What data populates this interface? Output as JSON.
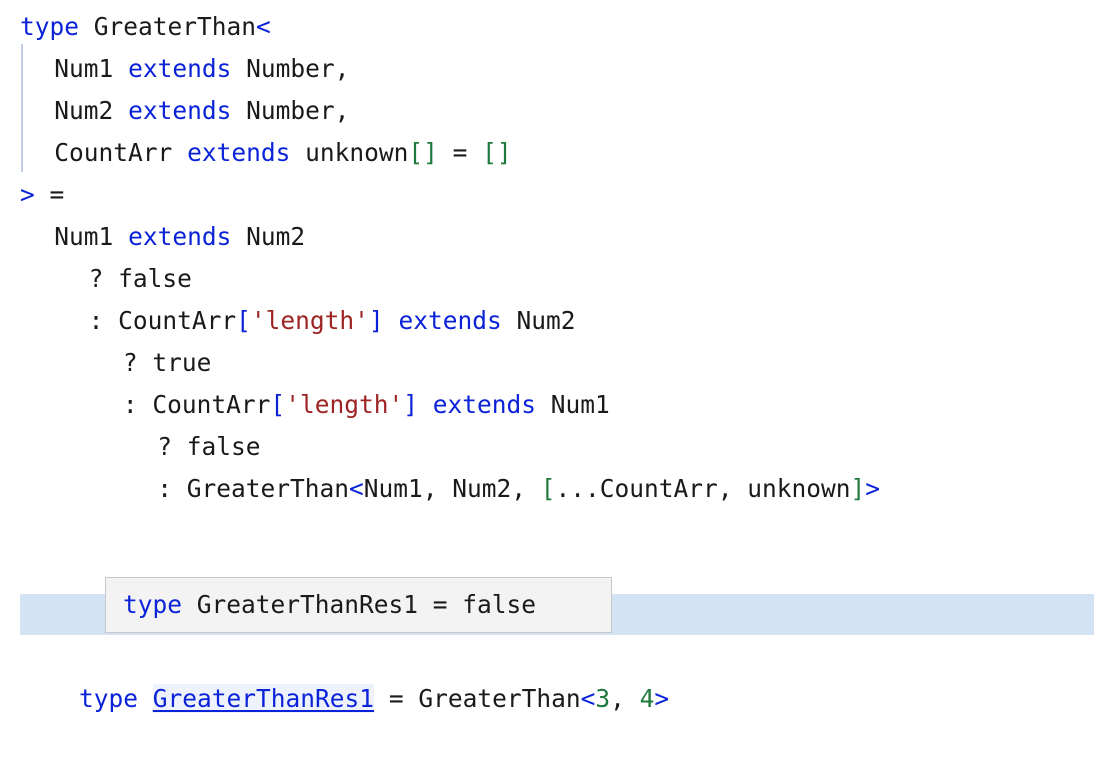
{
  "editor": {
    "language": "typescript",
    "background": "#ffffff",
    "colors": {
      "keyword": "#0b23d8",
      "identifier": "#1a1a1a",
      "string": "#9c2423",
      "number": "#1f7a3d",
      "bracket_green": "#1f7a3d",
      "bracket_blue": "#0b23d8",
      "highlight_band": "#d3e3f3",
      "tooltip_bg": "#f3f3f3",
      "tooltip_border": "#c8c8c8",
      "indent_guide": "#c3cde4",
      "link_bg": "#eef2fc"
    }
  },
  "code": {
    "lines": [
      {
        "indent": 0,
        "tokens": [
          {
            "t": "type",
            "c": "kw"
          },
          {
            "t": " ",
            "c": "punct"
          },
          {
            "t": "GreaterThan",
            "c": "ident"
          },
          {
            "t": "<",
            "c": "angle"
          }
        ]
      },
      {
        "indent": 2,
        "tokens": [
          {
            "t": "Num1",
            "c": "ident"
          },
          {
            "t": " ",
            "c": "punct"
          },
          {
            "t": "extends",
            "c": "kw"
          },
          {
            "t": " ",
            "c": "punct"
          },
          {
            "t": "Number,",
            "c": "ident"
          }
        ]
      },
      {
        "indent": 2,
        "tokens": [
          {
            "t": "Num2",
            "c": "ident"
          },
          {
            "t": " ",
            "c": "punct"
          },
          {
            "t": "extends",
            "c": "kw"
          },
          {
            "t": " ",
            "c": "punct"
          },
          {
            "t": "Number,",
            "c": "ident"
          }
        ]
      },
      {
        "indent": 2,
        "tokens": [
          {
            "t": "CountArr",
            "c": "ident"
          },
          {
            "t": " ",
            "c": "punct"
          },
          {
            "t": "extends",
            "c": "kw"
          },
          {
            "t": " ",
            "c": "punct"
          },
          {
            "t": "unknown",
            "c": "ident"
          },
          {
            "t": "[]",
            "c": "brk-grn"
          },
          {
            "t": " = ",
            "c": "punct"
          },
          {
            "t": "[]",
            "c": "brk-grn"
          }
        ]
      },
      {
        "indent": 0,
        "tokens": [
          {
            "t": ">",
            "c": "angle"
          },
          {
            "t": " =",
            "c": "punct"
          }
        ]
      },
      {
        "indent": 2,
        "tokens": [
          {
            "t": "Num1",
            "c": "ident"
          },
          {
            "t": " ",
            "c": "punct"
          },
          {
            "t": "extends",
            "c": "kw"
          },
          {
            "t": " ",
            "c": "punct"
          },
          {
            "t": "Num2",
            "c": "ident"
          }
        ]
      },
      {
        "indent": 4,
        "tokens": [
          {
            "t": "? ",
            "c": "punct"
          },
          {
            "t": "false",
            "c": "ident"
          }
        ]
      },
      {
        "indent": 4,
        "tokens": [
          {
            "t": ": ",
            "c": "punct"
          },
          {
            "t": "CountArr",
            "c": "ident"
          },
          {
            "t": "[",
            "c": "brk-blue"
          },
          {
            "t": "'length'",
            "c": "str"
          },
          {
            "t": "]",
            "c": "brk-blue"
          },
          {
            "t": " ",
            "c": "punct"
          },
          {
            "t": "extends",
            "c": "kw"
          },
          {
            "t": " ",
            "c": "punct"
          },
          {
            "t": "Num2",
            "c": "ident"
          }
        ]
      },
      {
        "indent": 6,
        "tokens": [
          {
            "t": "? ",
            "c": "punct"
          },
          {
            "t": "true",
            "c": "ident"
          }
        ]
      },
      {
        "indent": 6,
        "tokens": [
          {
            "t": ": ",
            "c": "punct"
          },
          {
            "t": "CountArr",
            "c": "ident"
          },
          {
            "t": "[",
            "c": "brk-blue"
          },
          {
            "t": "'length'",
            "c": "str"
          },
          {
            "t": "]",
            "c": "brk-blue"
          },
          {
            "t": " ",
            "c": "punct"
          },
          {
            "t": "extends",
            "c": "kw"
          },
          {
            "t": " ",
            "c": "punct"
          },
          {
            "t": "Num1",
            "c": "ident"
          }
        ]
      },
      {
        "indent": 8,
        "tokens": [
          {
            "t": "? ",
            "c": "punct"
          },
          {
            "t": "false",
            "c": "ident"
          }
        ]
      },
      {
        "indent": 8,
        "tokens": [
          {
            "t": ": ",
            "c": "punct"
          },
          {
            "t": "GreaterThan",
            "c": "ident"
          },
          {
            "t": "<",
            "c": "angle"
          },
          {
            "t": "Num1, Num2, ",
            "c": "ident"
          },
          {
            "t": "[",
            "c": "brk-grn"
          },
          {
            "t": "...CountArr, unknown",
            "c": "ident"
          },
          {
            "t": "]",
            "c": "brk-grn"
          },
          {
            "t": ">",
            "c": "angle"
          }
        ]
      }
    ]
  },
  "tooltip": {
    "visible": true,
    "tokens": [
      {
        "t": "type",
        "c": "kw"
      },
      {
        "t": " GreaterThanRes1 = false",
        "c": "ident"
      }
    ],
    "plain_text": "type GreaterThanRes1 = false"
  },
  "declaration": {
    "keyword": "type",
    "name": "GreaterThanRes1",
    "equals": " = ",
    "rhs_name": "GreaterThan",
    "open_angle": "<",
    "arg1": "3",
    "comma": ", ",
    "arg2": "4",
    "close_angle": ">",
    "plain_text": "type GreaterThanRes1 = GreaterThan<3, 4>"
  }
}
